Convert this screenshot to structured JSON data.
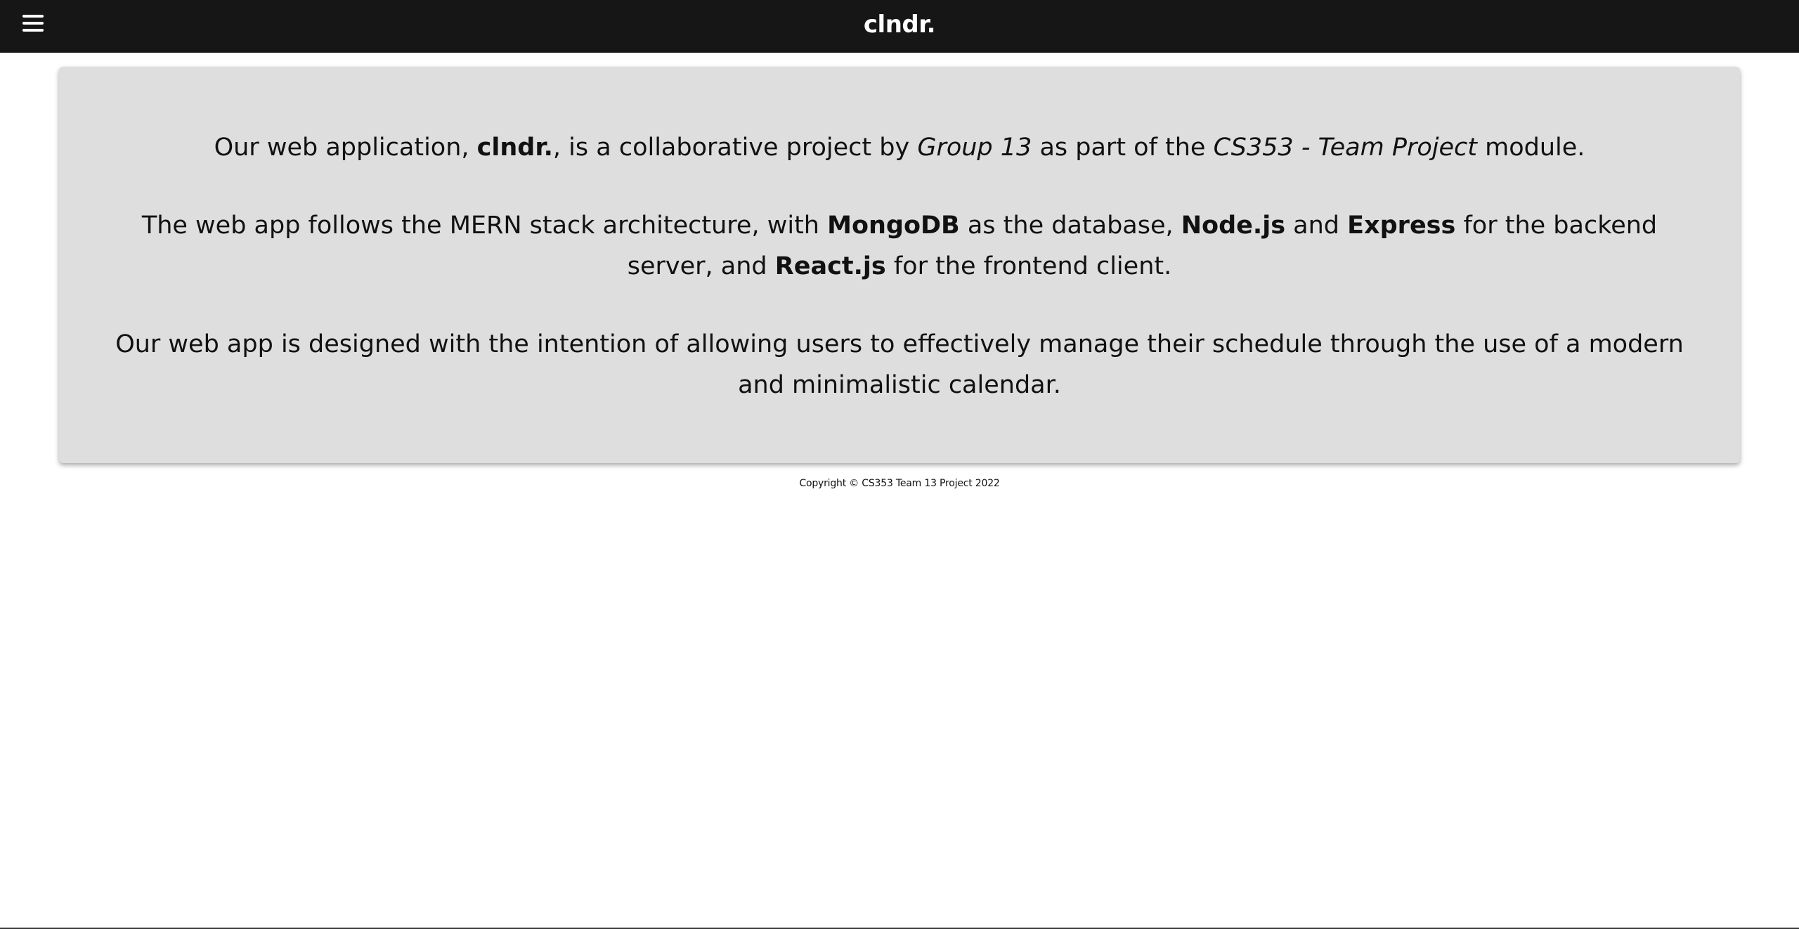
{
  "navbar": {
    "menu_icon": "hamburger-menu-icon",
    "brand": "clndr."
  },
  "about": {
    "p1": {
      "t1": "Our web application, ",
      "b1": "clndr.",
      "t2": ", is a collaborative project by ",
      "i1": "Group 13",
      "t3": " as part of the ",
      "i2": "CS353 - Team Project",
      "t4": " module."
    },
    "p2": {
      "t1": "The web app follows the MERN stack architecture, with ",
      "b1": "MongoDB",
      "t2": " as the database, ",
      "b2": "Node.js",
      "t3": " and ",
      "b3": "Express",
      "t4": " for the backend server, and ",
      "b4": "React.js",
      "t5": " for the frontend client."
    },
    "p3": {
      "t1": "Our web app is designed with the intention of allowing users to effectively manage their schedule through the use of a modern and minimalistic calendar."
    }
  },
  "footer": {
    "copyright": "Copyright © CS353 Team 13 Project 2022"
  },
  "colors": {
    "navbar_bg": "#161616",
    "card_bg": "#dedede",
    "text": "#111111",
    "brand_text": "#ffffff"
  }
}
